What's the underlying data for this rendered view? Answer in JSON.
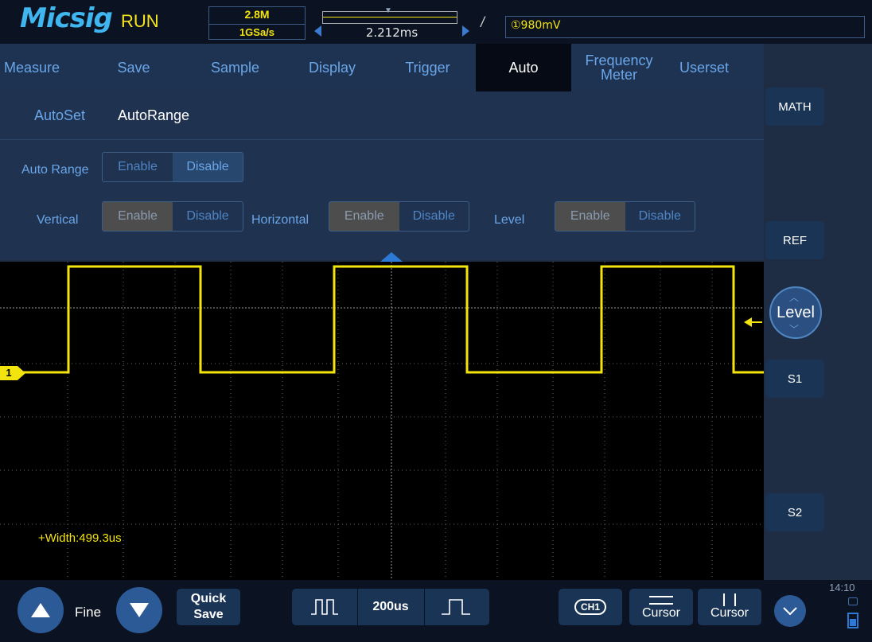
{
  "top": {
    "brand": "Micsig",
    "status": "RUN",
    "memory_depth": "2.8M",
    "sample_rate": "1GSa/s",
    "time_position": "2.212ms",
    "trigger_level": "①980mV"
  },
  "tabs": [
    {
      "label": "Measure"
    },
    {
      "label": "Save"
    },
    {
      "label": "Sample"
    },
    {
      "label": "Display"
    },
    {
      "label": "Trigger"
    },
    {
      "label": "Auto"
    },
    {
      "label": "Frequency Meter"
    },
    {
      "label": "Userset"
    }
  ],
  "subtabs": {
    "autoset": "AutoSet",
    "autorange": "AutoRange"
  },
  "settings": {
    "auto_range": {
      "label": "Auto Range",
      "enable": "Enable",
      "disable": "Disable",
      "selected": "Disable"
    },
    "vertical": {
      "label": "Vertical",
      "enable": "Enable",
      "disable": "Disable",
      "selected": "Enable"
    },
    "horizontal": {
      "label": "Horizontal",
      "enable": "Enable",
      "disable": "Disable",
      "selected": "Enable"
    },
    "level": {
      "label": "Level",
      "enable": "Enable",
      "disable": "Disable",
      "selected": "Enable"
    }
  },
  "waveform": {
    "channel": "1",
    "measurement": "+Width:499.3us",
    "color": "#f4e40e"
  },
  "right_panel": {
    "math": "MATH",
    "ref": "REF",
    "level": "Level",
    "s1": "S1",
    "s2": "S2",
    "time": "14:10"
  },
  "bottom": {
    "fine": "Fine",
    "quick_save_line1": "Quick",
    "quick_save_line2": "Save",
    "timebase": "200us",
    "ch1": "CH1",
    "cursor_h": "Cursor",
    "cursor_v": "Cursor"
  }
}
